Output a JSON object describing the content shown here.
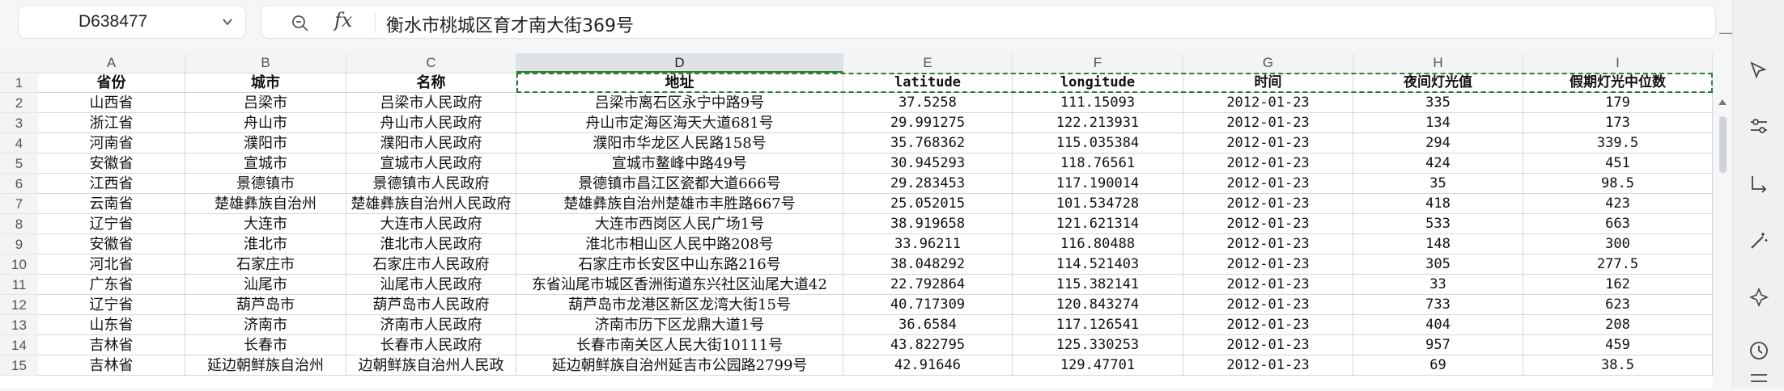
{
  "name_box": {
    "value": "D638477"
  },
  "formula_bar": {
    "fx_label": "fx",
    "content": "衡水市桃城区育才南大街369号"
  },
  "columns": [
    "A",
    "B",
    "C",
    "D",
    "E",
    "F",
    "G",
    "H",
    "I"
  ],
  "selected_column": "D",
  "rows": [
    {
      "num": "1",
      "cells": [
        "省份",
        "城市",
        "名称",
        "地址",
        "latitude",
        "longitude",
        "时间",
        "夜间灯光值",
        "假期灯光中位数"
      ]
    },
    {
      "num": "2",
      "cells": [
        "山西省",
        "吕梁市",
        "吕梁市人民政府",
        "吕梁市离石区永宁中路9号",
        "37.5258",
        "111.15093",
        "2012-01-23",
        "335",
        "179"
      ]
    },
    {
      "num": "3",
      "cells": [
        "浙江省",
        "舟山市",
        "舟山市人民政府",
        "舟山市定海区海天大道681号",
        "29.991275",
        "122.213931",
        "2012-01-23",
        "134",
        "173"
      ]
    },
    {
      "num": "4",
      "cells": [
        "河南省",
        "濮阳市",
        "濮阳市人民政府",
        "濮阳市华龙区人民路158号",
        "35.768362",
        "115.035384",
        "2012-01-23",
        "294",
        "339.5"
      ]
    },
    {
      "num": "5",
      "cells": [
        "安徽省",
        "宣城市",
        "宣城市人民政府",
        "宣城市鳌峰中路49号",
        "30.945293",
        "118.76561",
        "2012-01-23",
        "424",
        "451"
      ]
    },
    {
      "num": "6",
      "cells": [
        "江西省",
        "景德镇市",
        "景德镇市人民政府",
        "景德镇市昌江区瓷都大道666号",
        "29.283453",
        "117.190014",
        "2012-01-23",
        "35",
        "98.5"
      ]
    },
    {
      "num": "7",
      "cells": [
        "云南省",
        "楚雄彝族自治州",
        "楚雄彝族自治州人民政府",
        "楚雄彝族自治州楚雄市丰胜路667号",
        "25.052015",
        "101.534728",
        "2012-01-23",
        "418",
        "423"
      ]
    },
    {
      "num": "8",
      "cells": [
        "辽宁省",
        "大连市",
        "大连市人民政府",
        "大连市西岗区人民广场1号",
        "38.919658",
        "121.621314",
        "2012-01-23",
        "533",
        "663"
      ]
    },
    {
      "num": "9",
      "cells": [
        "安徽省",
        "淮北市",
        "淮北市人民政府",
        "淮北市相山区人民中路208号",
        "33.96211",
        "116.80488",
        "2012-01-23",
        "148",
        "300"
      ]
    },
    {
      "num": "10",
      "cells": [
        "河北省",
        "石家庄市",
        "石家庄市人民政府",
        "石家庄市长安区中山东路216号",
        "38.048292",
        "114.521403",
        "2012-01-23",
        "305",
        "277.5"
      ]
    },
    {
      "num": "11",
      "cells": [
        "广东省",
        "汕尾市",
        "汕尾市人民政府",
        "东省汕尾市城区香洲街道东兴社区汕尾大道42",
        "22.792864",
        "115.382141",
        "2012-01-23",
        "33",
        "162"
      ]
    },
    {
      "num": "12",
      "cells": [
        "辽宁省",
        "葫芦岛市",
        "葫芦岛市人民政府",
        "葫芦岛市龙港区新区龙湾大街15号",
        "40.717309",
        "120.843274",
        "2012-01-23",
        "733",
        "623"
      ]
    },
    {
      "num": "13",
      "cells": [
        "山东省",
        "济南市",
        "济南市人民政府",
        "济南市历下区龙鼎大道1号",
        "36.6584",
        "117.126541",
        "2012-01-23",
        "404",
        "208"
      ]
    },
    {
      "num": "14",
      "cells": [
        "吉林省",
        "长春市",
        "长春市人民政府",
        "长春市南关区人民大街10111号",
        "43.822795",
        "125.330253",
        "2012-01-23",
        "957",
        "459"
      ]
    },
    {
      "num": "15",
      "cells": [
        "吉林省",
        "延边朝鲜族自治州",
        "边朝鲜族自治州人民政",
        "延边朝鲜族自治州延吉市公园路2799号",
        "42.91646",
        "129.47701",
        "2012-01-23",
        "69",
        "38.5"
      ]
    }
  ],
  "colors": {
    "accent": "#2e7d32",
    "grid": "#d4d6d9",
    "header_bg": "#f3f4f5"
  },
  "right_panel_icons": [
    "cursor-icon",
    "sliders-icon",
    "transform-icon",
    "wand-icon",
    "sparkle-icon",
    "clock-icon",
    "split-icon"
  ]
}
